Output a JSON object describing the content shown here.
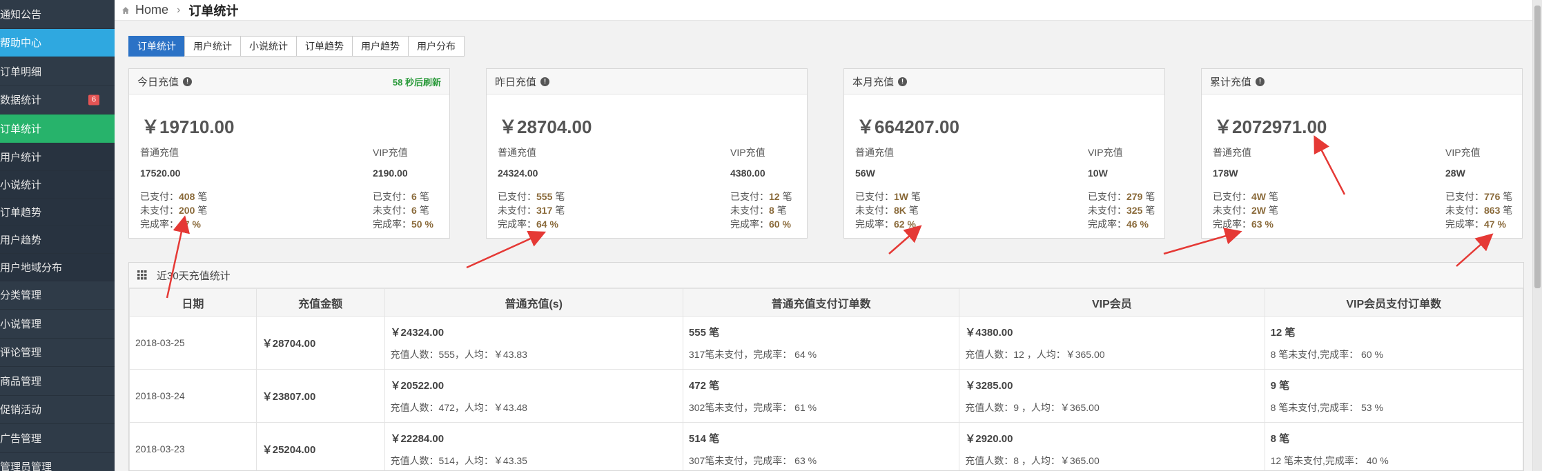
{
  "sidebar": {
    "items": [
      {
        "label": "通知公告",
        "state": "normal"
      },
      {
        "label": "帮助中心",
        "state": "active-blue"
      },
      {
        "label": "订单明细",
        "state": "normal"
      },
      {
        "label": "数据统计",
        "state": "normal",
        "badge": "6"
      },
      {
        "label": "订单统计",
        "state": "active-green"
      },
      {
        "label": "用户统计",
        "state": "sub"
      },
      {
        "label": "小说统计",
        "state": "sub"
      },
      {
        "label": "订单趋势",
        "state": "sub"
      },
      {
        "label": "用户趋势",
        "state": "sub"
      },
      {
        "label": "用户地域分布",
        "state": "sub"
      },
      {
        "label": "分类管理",
        "state": "normal"
      },
      {
        "label": "小说管理",
        "state": "normal"
      },
      {
        "label": "评论管理",
        "state": "normal"
      },
      {
        "label": "商品管理",
        "state": "normal"
      },
      {
        "label": "促销活动",
        "state": "normal"
      },
      {
        "label": "广告管理",
        "state": "normal"
      },
      {
        "label": "管理员管理",
        "state": "normal"
      }
    ]
  },
  "breadcrumb": {
    "home": "Home",
    "sep": "›",
    "current": "订单统计"
  },
  "tabs": [
    "订单统计",
    "用户统计",
    "小说统计",
    "订单趋势",
    "用户趋势",
    "用户分布"
  ],
  "cards": [
    {
      "title": "今日充值",
      "refresh": "58 秒后刷新",
      "total": "￥19710.00",
      "left": {
        "label": "普通充值",
        "amount": "17520.00",
        "paid_label": "已支付：",
        "paid": "408",
        "unpaid_label": "未支付：",
        "unpaid": "200",
        "rate_label": "完成率：",
        "rate": "67 %"
      },
      "right": {
        "label": "VIP充值",
        "amount": "2190.00",
        "paid_label": "已支付：",
        "paid": "6",
        "unpaid_label": "未支付：",
        "unpaid": "6",
        "rate_label": "完成率：",
        "rate": "50 %"
      }
    },
    {
      "title": "昨日充值",
      "refresh": "",
      "total": "￥28704.00",
      "left": {
        "label": "普通充值",
        "amount": "24324.00",
        "paid_label": "已支付：",
        "paid": "555",
        "unpaid_label": "未支付：",
        "unpaid": "317",
        "rate_label": "完成率：",
        "rate": "64 %"
      },
      "right": {
        "label": "VIP充值",
        "amount": "4380.00",
        "paid_label": "已支付：",
        "paid": "12",
        "unpaid_label": "未支付：",
        "unpaid": "8",
        "rate_label": "完成率：",
        "rate": "60 %"
      }
    },
    {
      "title": "本月充值",
      "refresh": "",
      "total": "￥664207.00",
      "left": {
        "label": "普通充值",
        "amount": "56W",
        "paid_label": "已支付：",
        "paid": "1W",
        "unpaid_label": "未支付：",
        "unpaid": "8K",
        "rate_label": "完成率：",
        "rate": "62 %"
      },
      "right": {
        "label": "VIP充值",
        "amount": "10W",
        "paid_label": "已支付：",
        "paid": "279",
        "unpaid_label": "未支付：",
        "unpaid": "325",
        "rate_label": "完成率：",
        "rate": "46 %"
      }
    },
    {
      "title": "累计充值",
      "refresh": "",
      "total": "￥2072971.00",
      "left": {
        "label": "普通充值",
        "amount": "178W",
        "paid_label": "已支付：",
        "paid": "4W",
        "unpaid_label": "未支付：",
        "unpaid": "2W",
        "rate_label": "完成率：",
        "rate": "63 %"
      },
      "right": {
        "label": "VIP充值",
        "amount": "28W",
        "paid_label": "已支付：",
        "paid": "776",
        "unpaid_label": "未支付：",
        "unpaid": "863",
        "rate_label": "完成率：",
        "rate": "47 %"
      }
    }
  ],
  "unit": "笔",
  "table": {
    "title": "近30天充值统计",
    "headers": [
      "日期",
      "充值金额",
      "普通充值(s)",
      "普通充值支付订单数",
      "VIP会员",
      "VIP会员支付订单数"
    ],
    "rows": [
      {
        "date": "2018-03-25",
        "amount": "￥28704.00",
        "normal": "￥24324.00",
        "normal_sub": "充值人数：555，人均：￥43.83",
        "normal_orders": "555 笔",
        "normal_orders_sub": "317笔未支付，完成率： 64 %",
        "vip": "￥4380.00",
        "vip_sub": "充值人数：12 ，人均：￥365.00",
        "vip_orders": "12 笔",
        "vip_orders_sub": "8 笔未支付,完成率： 60 %"
      },
      {
        "date": "2018-03-24",
        "amount": "￥23807.00",
        "normal": "￥20522.00",
        "normal_sub": "充值人数：472，人均：￥43.48",
        "normal_orders": "472 笔",
        "normal_orders_sub": "302笔未支付，完成率： 61 %",
        "vip": "￥3285.00",
        "vip_sub": "充值人数：9 ，人均：￥365.00",
        "vip_orders": "9 笔",
        "vip_orders_sub": "8 笔未支付,完成率： 53 %"
      },
      {
        "date": "2018-03-23",
        "amount": "￥25204.00",
        "normal": "￥22284.00",
        "normal_sub": "充值人数：514，人均：￥43.35",
        "normal_orders": "514 笔",
        "normal_orders_sub": "307笔未支付，完成率： 63 %",
        "vip": "￥2920.00",
        "vip_sub": "充值人数：8 ，人均：￥365.00",
        "vip_orders": "8 笔",
        "vip_orders_sub": "12 笔未支付,完成率： 40 %"
      }
    ]
  },
  "colors": {
    "sidebar": "#2f3b48",
    "active_blue": "#2fa8e0",
    "active_green": "#27b36b",
    "tab_active": "#2b72c6",
    "badge": "#e45454",
    "refresh": "#2a9a3a",
    "annotation_arrow": "#e53935"
  },
  "icons": {
    "home": "home-icon",
    "info": "info-icon",
    "grid": "grid-icon"
  }
}
